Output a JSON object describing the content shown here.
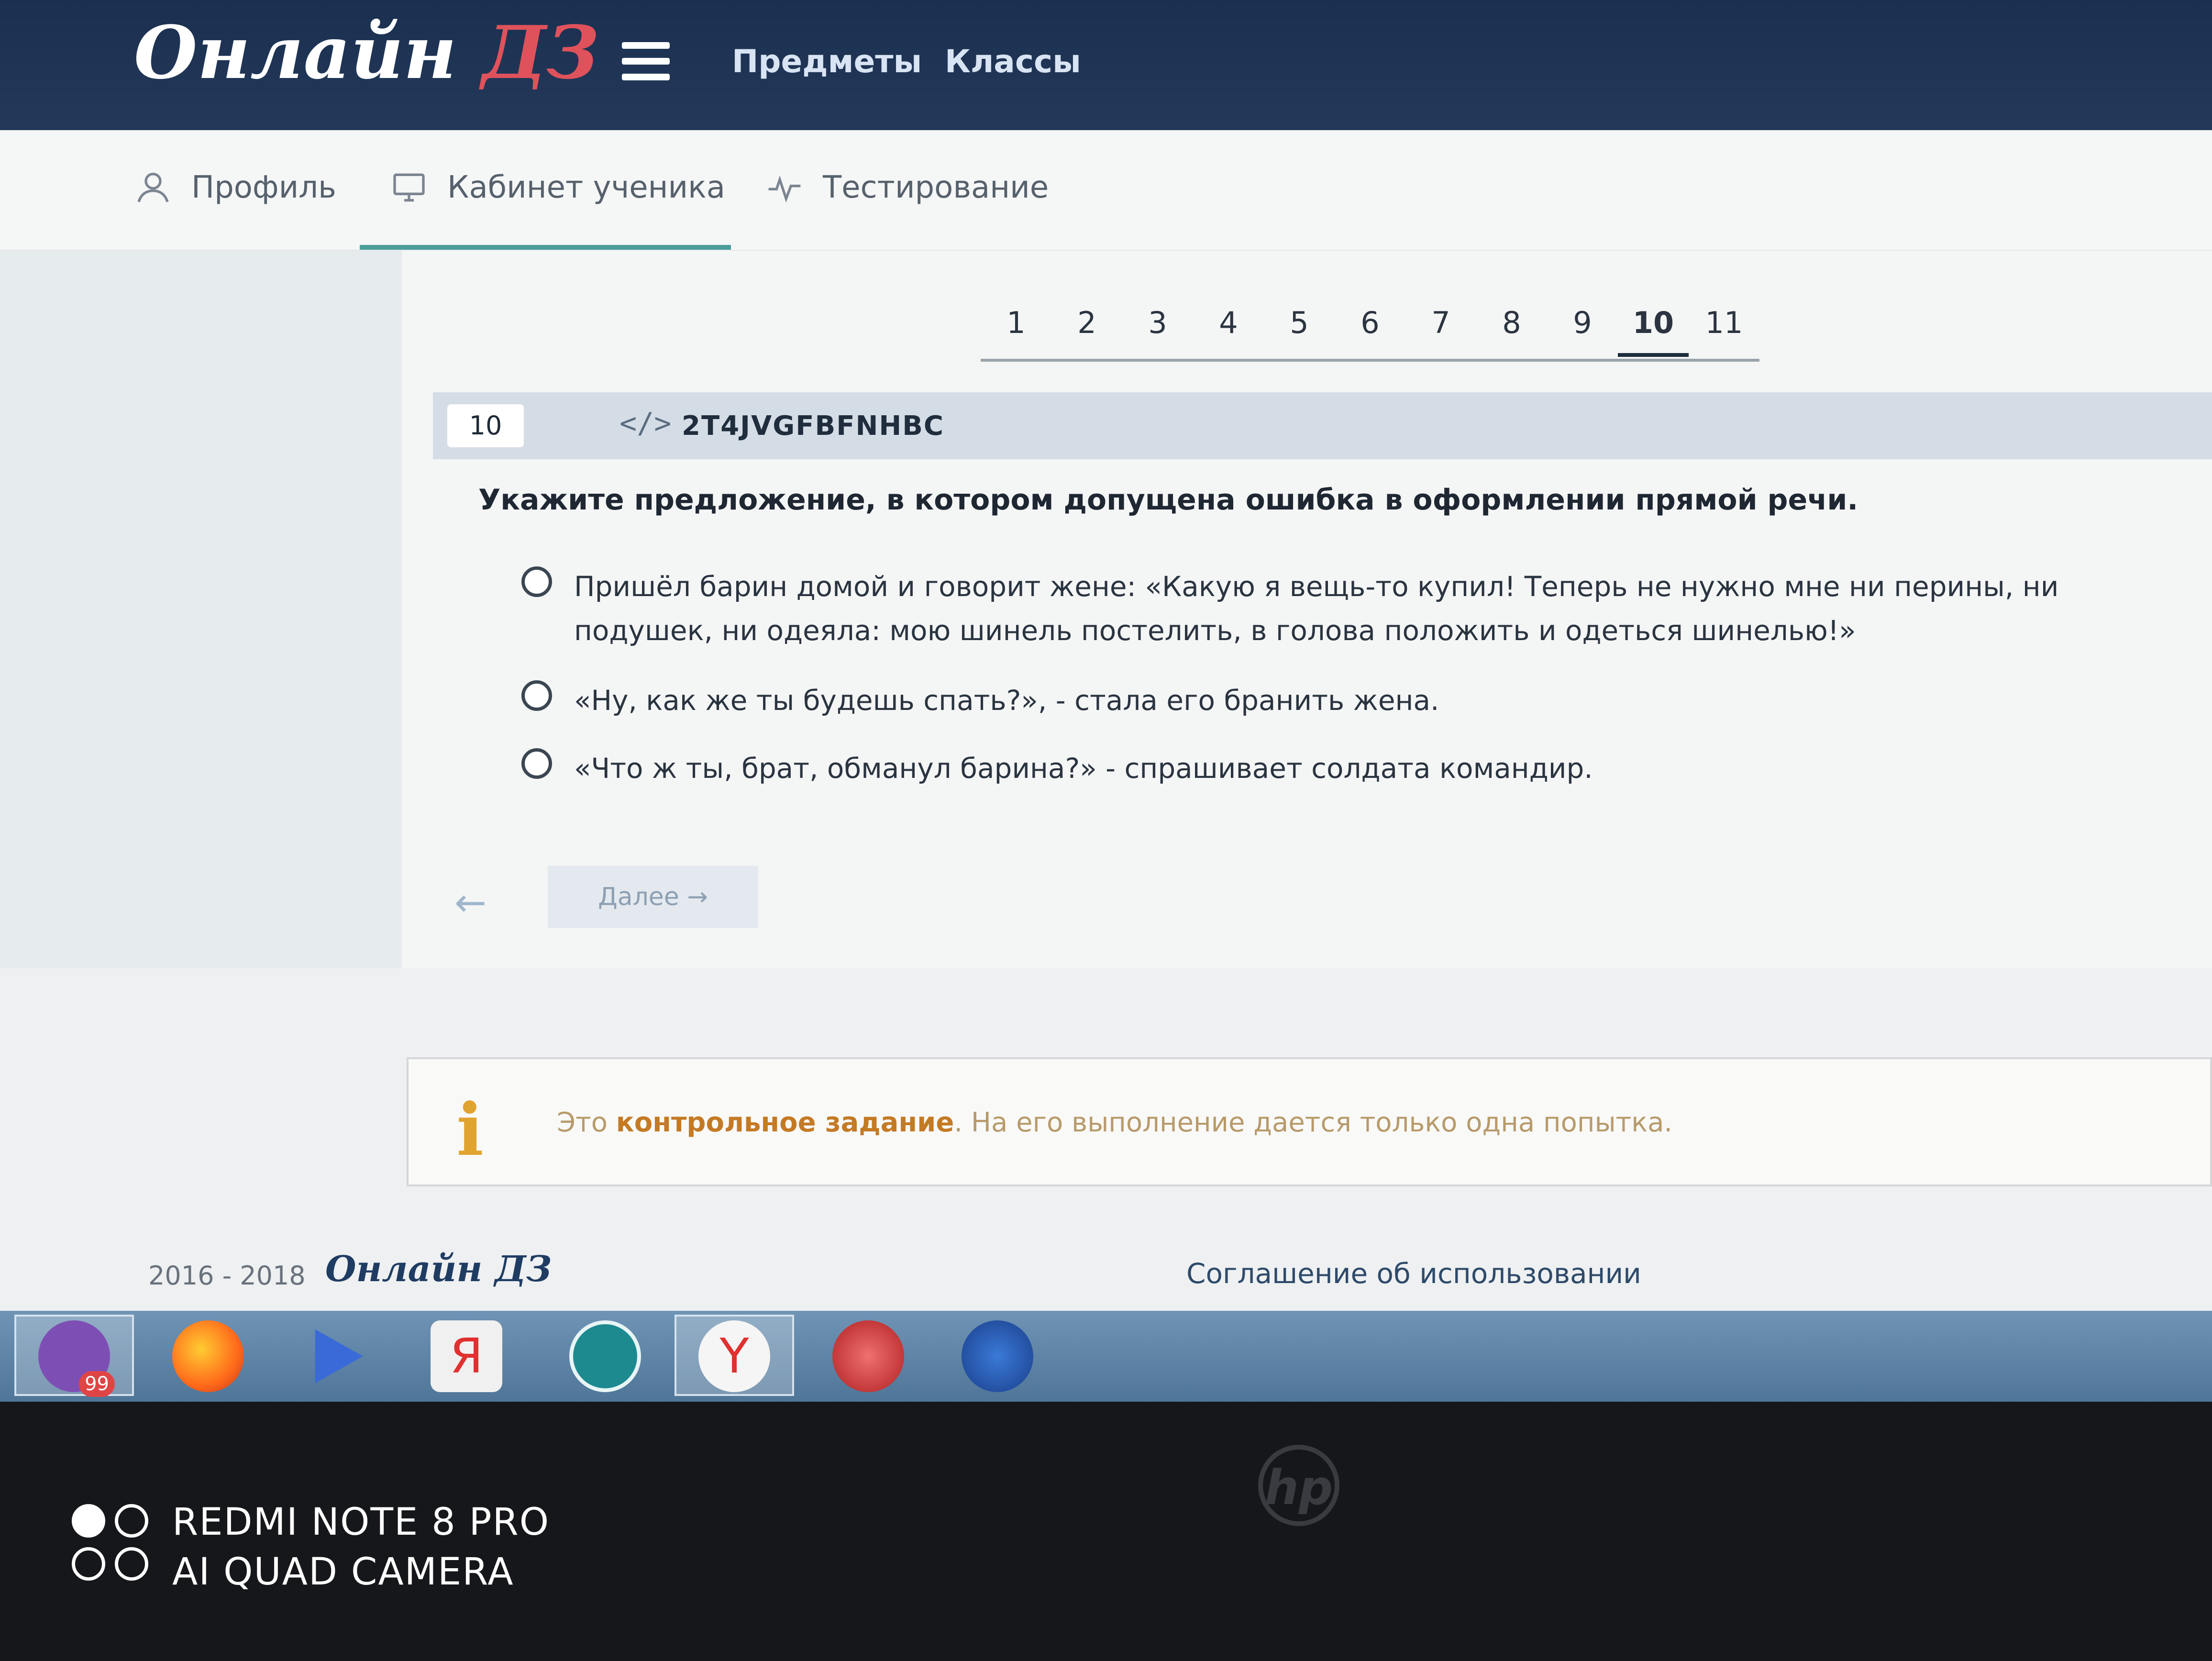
{
  "header": {
    "logo_main": "Онлайн",
    "logo_accent": "ДЗ",
    "nav": [
      "Предметы",
      "Классы"
    ]
  },
  "subnav": {
    "items": [
      {
        "label": "Профиль",
        "icon": "user-icon"
      },
      {
        "label": "Кабинет ученика",
        "icon": "monitor-icon"
      },
      {
        "label": "Тестирование",
        "icon": "pulse-icon"
      }
    ],
    "active_index": 1
  },
  "pagination": {
    "pages": [
      "1",
      "2",
      "3",
      "4",
      "5",
      "6",
      "7",
      "8",
      "9",
      "10",
      "11"
    ],
    "current": "10"
  },
  "task": {
    "number": "10",
    "code": "2T4JVGFBFNHBC",
    "question": "Укажите предложение, в котором допущена ошибка в оформлении прямой речи.",
    "options": [
      "Пришёл барин домой и говорит жене: «Какую я вещь-то купил! Теперь не нужно мне ни перины, ни подушек, ни одеяла: мою шинель постелить, в голова положить и одеться шинелью!»",
      "«Ну, как же ты будешь спать?», - стала его бранить жена.",
      "«Что ж ты, брат, обманул барина?» - спрашивает солдата командир."
    ],
    "next_label": "Далее"
  },
  "info": {
    "prefix": "Это",
    "highlight": "контрольное задание",
    "suffix": ". На его выполнение дается только одна попытка."
  },
  "footer": {
    "years": "2016 - 2018",
    "logo": "Онлайн ДЗ",
    "agreement": "Соглашение об использовании"
  },
  "taskbar": {
    "icons": [
      "viber-icon",
      "firefox-icon",
      "media-player-icon",
      "yandex-icon",
      "defender-icon",
      "yandex-browser-icon",
      "gift-icon",
      "windows-store-icon"
    ],
    "viber_badge": "99"
  },
  "device": {
    "brand": "hp",
    "watermark_line1": "REDMI NOTE 8 PRO",
    "watermark_line2": "AI QUAD CAMERA"
  },
  "colors": {
    "header_bg": "#1b3050",
    "logo_accent": "#e0525b",
    "active_tab": "#4a9d9a",
    "info_accent": "#e1a330"
  }
}
